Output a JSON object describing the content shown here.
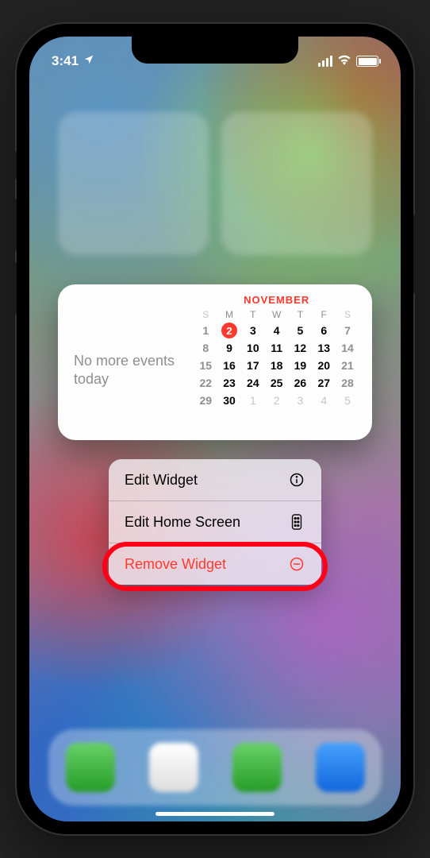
{
  "status": {
    "time": "3:41",
    "signal": 4,
    "wifi": true,
    "battery_pct": 100
  },
  "widget": {
    "message": "No more events today",
    "month": "NOVEMBER",
    "weekdays": [
      "S",
      "M",
      "T",
      "W",
      "T",
      "F",
      "S"
    ],
    "today": 2,
    "rows": [
      [
        {
          "n": 1,
          "w": true
        },
        {
          "n": 2,
          "t": true
        },
        {
          "n": 3
        },
        {
          "n": 4
        },
        {
          "n": 5
        },
        {
          "n": 6
        },
        {
          "n": 7,
          "w": true
        }
      ],
      [
        {
          "n": 8,
          "w": true
        },
        {
          "n": 9
        },
        {
          "n": 10
        },
        {
          "n": 11
        },
        {
          "n": 12
        },
        {
          "n": 13
        },
        {
          "n": 14,
          "w": true
        }
      ],
      [
        {
          "n": 15,
          "w": true
        },
        {
          "n": 16
        },
        {
          "n": 17
        },
        {
          "n": 18
        },
        {
          "n": 19
        },
        {
          "n": 20
        },
        {
          "n": 21,
          "w": true
        }
      ],
      [
        {
          "n": 22,
          "w": true
        },
        {
          "n": 23
        },
        {
          "n": 24
        },
        {
          "n": 25
        },
        {
          "n": 26
        },
        {
          "n": 27
        },
        {
          "n": 28,
          "w": true
        }
      ],
      [
        {
          "n": 29,
          "w": true
        },
        {
          "n": 30
        },
        {
          "n": 1,
          "o": true
        },
        {
          "n": 2,
          "o": true
        },
        {
          "n": 3,
          "o": true
        },
        {
          "n": 4,
          "o": true
        },
        {
          "n": 5,
          "o": true
        }
      ]
    ]
  },
  "menu": {
    "edit_widget": "Edit Widget",
    "edit_home": "Edit Home Screen",
    "remove_widget": "Remove Widget"
  },
  "highlight_target": "remove-widget-menu-item",
  "colors": {
    "accent_red": "#ff3b30",
    "status_white": "#ffffff"
  }
}
